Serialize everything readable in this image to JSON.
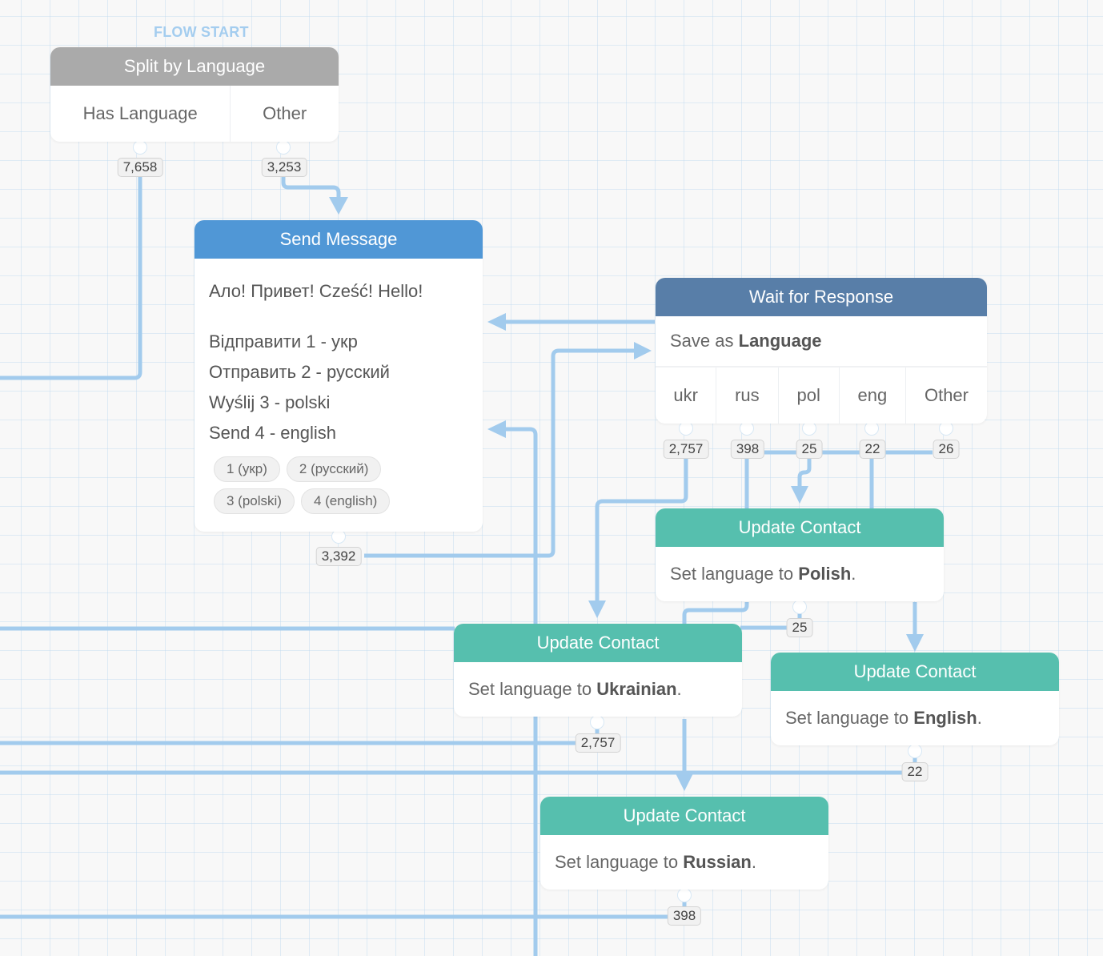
{
  "canvas": {
    "flow_start_label": "FLOW START",
    "wire_color": "#a2cbed",
    "grid_color": "#e2eef8"
  },
  "nodes": {
    "split": {
      "title": "Split by Language",
      "header_color": "#aaaaaa",
      "categories": [
        {
          "label": "Has Language",
          "count": "7,658"
        },
        {
          "label": "Other",
          "count": "3,253"
        }
      ]
    },
    "send_message": {
      "title": "Send Message",
      "header_color": "#5097d6",
      "lines": [
        "Ало! Привет! Cześć! Hello!",
        "Відправити 1 - укр",
        "Отправить 2 - русский",
        "Wyślij 3 - polski",
        "Send 4 - english"
      ],
      "quick_replies": [
        "1 (укр)",
        "2 (русский)",
        "3 (polski)",
        "4 (english)"
      ],
      "count": "3,392"
    },
    "wait_response": {
      "title": "Wait for Response",
      "header_color": "#587ea8",
      "save_as_prefix": "Save as",
      "save_as_var": "Language",
      "categories": [
        {
          "label": "ukr",
          "count": "2,757"
        },
        {
          "label": "rus",
          "count": "398"
        },
        {
          "label": "pol",
          "count": "25"
        },
        {
          "label": "eng",
          "count": "22"
        },
        {
          "label": "Other",
          "count": "26"
        }
      ]
    },
    "update_polish": {
      "title": "Update Contact",
      "prefix": "Set language to",
      "value": "Polish",
      "suffix": ".",
      "count": "25"
    },
    "update_ukrainian": {
      "title": "Update Contact",
      "prefix": "Set language to",
      "value": "Ukrainian",
      "suffix": ".",
      "count": "2,757"
    },
    "update_english": {
      "title": "Update Contact",
      "prefix": "Set language to",
      "value": "English",
      "suffix": ".",
      "count": "22"
    },
    "update_russian": {
      "title": "Update Contact",
      "prefix": "Set language to",
      "value": "Russian",
      "suffix": ".",
      "count": "398"
    }
  }
}
